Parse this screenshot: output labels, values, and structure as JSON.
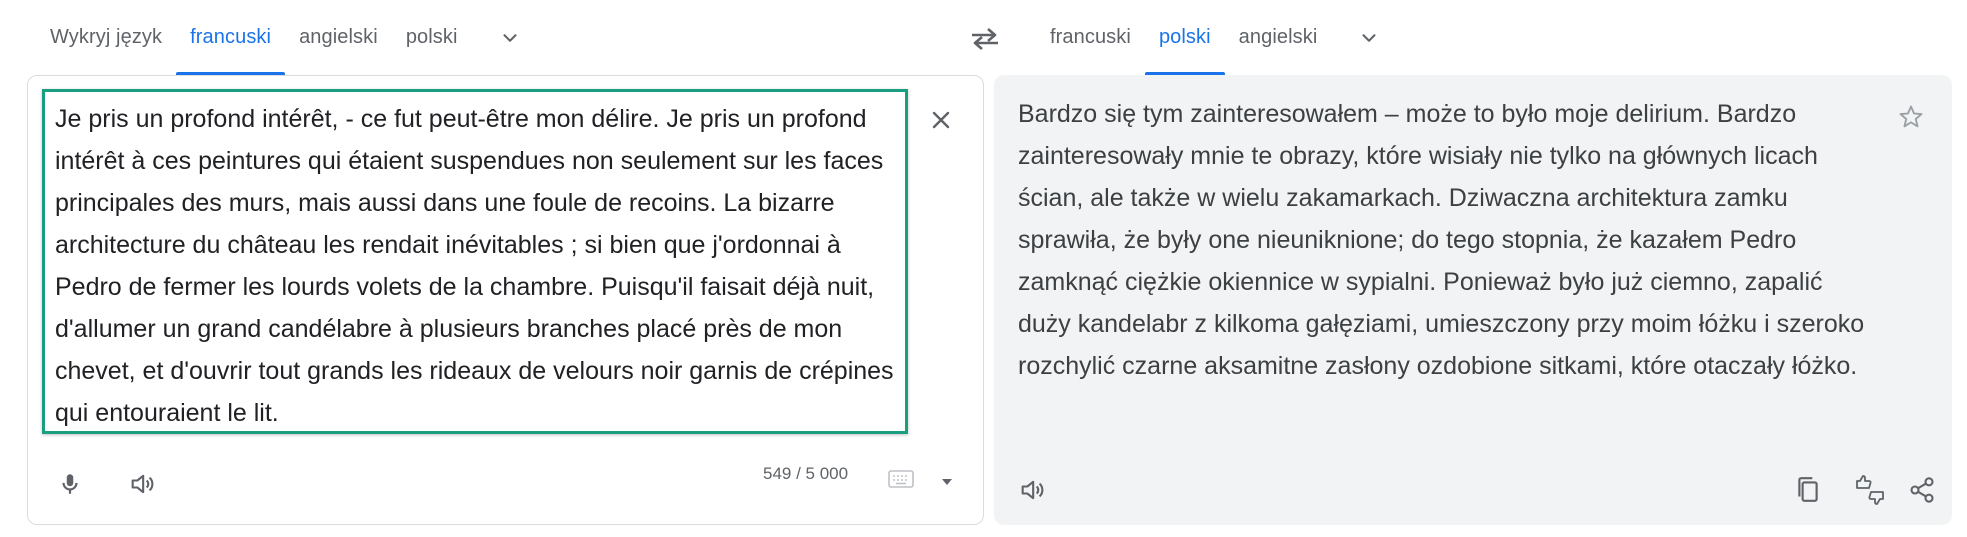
{
  "source_languages": {
    "tabs": [
      {
        "label": "Wykryj język",
        "active": false
      },
      {
        "label": "francuski",
        "active": true
      },
      {
        "label": "angielski",
        "active": false
      },
      {
        "label": "polski",
        "active": false
      }
    ],
    "more_icon": "chevron-down-icon"
  },
  "swap_icon": "swap-arrows-icon",
  "target_languages": {
    "tabs": [
      {
        "label": "francuski",
        "active": false
      },
      {
        "label": "polski",
        "active": true
      },
      {
        "label": "angielski",
        "active": false
      }
    ],
    "more_icon": "chevron-down-icon"
  },
  "source": {
    "text": "Je pris un profond intérêt, - ce fut peut-être mon délire. Je pris un profond intérêt à ces peintures qui étaient suspendues non seulement sur les faces principales des murs, mais aussi dans une foule de recoins. La bizarre architecture du château les rendait inévitables ; si bien que j'ordonnai à Pedro de fermer les lourds volets de la chambre. Puisqu'il faisait déjà nuit, d'allumer un grand candélabre à plusieurs branches placé près de mon chevet, et d'ouvrir tout grands les rideaux de velours noir garnis de crépines qui entouraient le lit.",
    "char_count": "549 / 5 000",
    "icons": [
      "close-icon",
      "microphone-icon",
      "speaker-icon",
      "keyboard-icon",
      "caret-down-icon"
    ]
  },
  "target": {
    "text": "Bardzo się tym zainteresowałem – może to było moje delirium. Bardzo zainteresowały mnie te obrazy, które wisiały nie tylko na głównych licach ścian, ale także w wielu zakamarkach. Dziwaczna architektura zamku sprawiła, że były one nieuniknione; do tego stopnia, że kazałem Pedro zamknąć ciężkie okiennice w sypialni. Ponieważ było już ciemno, zapalić duży kandelabr z kilkoma gałęziami, umieszczony przy moim łóżku i szeroko rozchylić czarne aksamitne zasłony ozdobione sitkami, które otaczały łóżko.",
    "icons": [
      "star-icon",
      "speaker-icon",
      "copy-icon",
      "feedback-icon",
      "share-icon"
    ]
  },
  "colors": {
    "accent": "#1a73e8",
    "source_highlight_border": "#1a9e7f",
    "target_panel_bg": "#f1f3f4",
    "icon_gray": "#5f6368"
  }
}
